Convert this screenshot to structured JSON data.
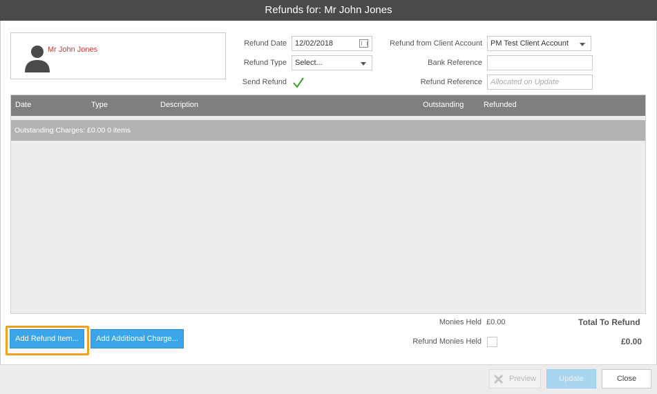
{
  "dialog": {
    "title": "Refunds for: Mr John Jones"
  },
  "client": {
    "name": "Mr John Jones"
  },
  "form": {
    "refund_date_label": "Refund Date",
    "refund_date_value": "12/02/2018",
    "refund_type_label": "Refund Type",
    "refund_type_value": "Select...",
    "send_refund_label": "Send Refund",
    "send_refund_checked": true,
    "client_account_label": "Refund from Client Account",
    "client_account_value": "PM Test Client Account",
    "bank_reference_label": "Bank Reference",
    "bank_reference_value": "",
    "refund_reference_label": "Refund Reference",
    "refund_reference_placeholder": "Allocated on Update"
  },
  "grid": {
    "columns": [
      "Date",
      "Type",
      "Description",
      "Outstanding",
      "Refunded"
    ],
    "group_label": "Outstanding Charges: £0.00 0 items"
  },
  "summary": {
    "monies_held_label": "Monies Held",
    "monies_held_value": "£0.00",
    "refund_monies_held_label": "Refund Monies Held",
    "total_label": "Total To Refund",
    "total_value": "£0.00"
  },
  "actions": {
    "add_refund_item": "Add Refund Item...",
    "add_additional_charge": "Add Additional Charge...",
    "preview": "Preview",
    "update": "Update",
    "close": "Close"
  },
  "colors": {
    "accent_blue": "#3aa5e8",
    "highlight_orange": "#f0a01f",
    "client_name_red": "#d43a2f",
    "check_green": "#3a9e2f"
  }
}
